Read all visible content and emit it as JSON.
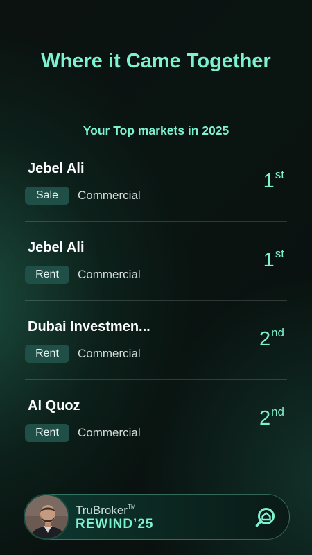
{
  "header": {
    "title": "Where it Came Together",
    "subtitle": "Your Top markets in 2025"
  },
  "markets": [
    {
      "area": "Jebel Ali",
      "purpose": "Sale",
      "type": "Commercial",
      "rank": "1",
      "rank_suffix": "st"
    },
    {
      "area": "Jebel Ali",
      "purpose": "Rent",
      "type": "Commercial",
      "rank": "1",
      "rank_suffix": "st"
    },
    {
      "area": "Dubai Investmen...",
      "purpose": "Rent",
      "type": "Commercial",
      "rank": "2",
      "rank_suffix": "nd"
    },
    {
      "area": "Al Quoz",
      "purpose": "Rent",
      "type": "Commercial",
      "rank": "2",
      "rank_suffix": "nd"
    }
  ],
  "footer": {
    "brand_name": "TruBroker",
    "trademark": "TM",
    "rewind_label": "REWIND’25",
    "icon": "home-search-icon"
  },
  "colors": {
    "accent": "#7ef2cf",
    "chip": "#1f4f47",
    "background": "#0a0f0e"
  }
}
